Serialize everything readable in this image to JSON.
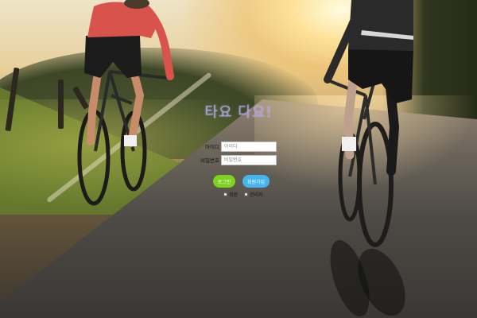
{
  "login": {
    "title": "타요 다요!",
    "id_label": "아이디",
    "id_placeholder": "아이디",
    "pw_label": "비밀번호",
    "pw_placeholder": "비밀번호",
    "login_button": "로그인",
    "join_button": "회원가입",
    "role_options": [
      "회원",
      "관리자"
    ]
  },
  "colors": {
    "title": "#a79cf2",
    "login_button": "#7ed321",
    "join_button": "#46b4ef"
  },
  "background": {
    "scene": "two cyclists on a sunlit road",
    "icons": [
      "cyclist-left-image",
      "cyclist-right-image"
    ]
  }
}
